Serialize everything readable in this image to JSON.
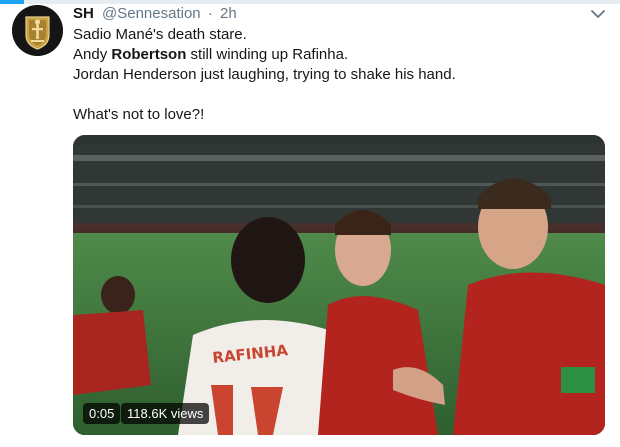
{
  "tweet": {
    "display_name": "SH",
    "handle": "@Sennesation",
    "separator": "·",
    "timestamp": "2h",
    "line1": "Sadio Mané's death stare.",
    "line2_prefix": "Andy ",
    "line2_bold": "Robertson",
    "line2_suffix": " still winding up Rafinha.",
    "line3": "Jordan Henderson just laughing, trying to shake his hand.",
    "line4": "What's not to love?!"
  },
  "media": {
    "duration": "0:05",
    "views": "118.6K views",
    "shirt_lettering": "RAFINHA"
  },
  "icons": {
    "menu": "chevron-down-icon",
    "avatar": "crest-logo"
  },
  "colors": {
    "accent": "#1da1f2",
    "text": "#14171a",
    "muted": "#657786",
    "liverpool_red": "#b3241f"
  }
}
